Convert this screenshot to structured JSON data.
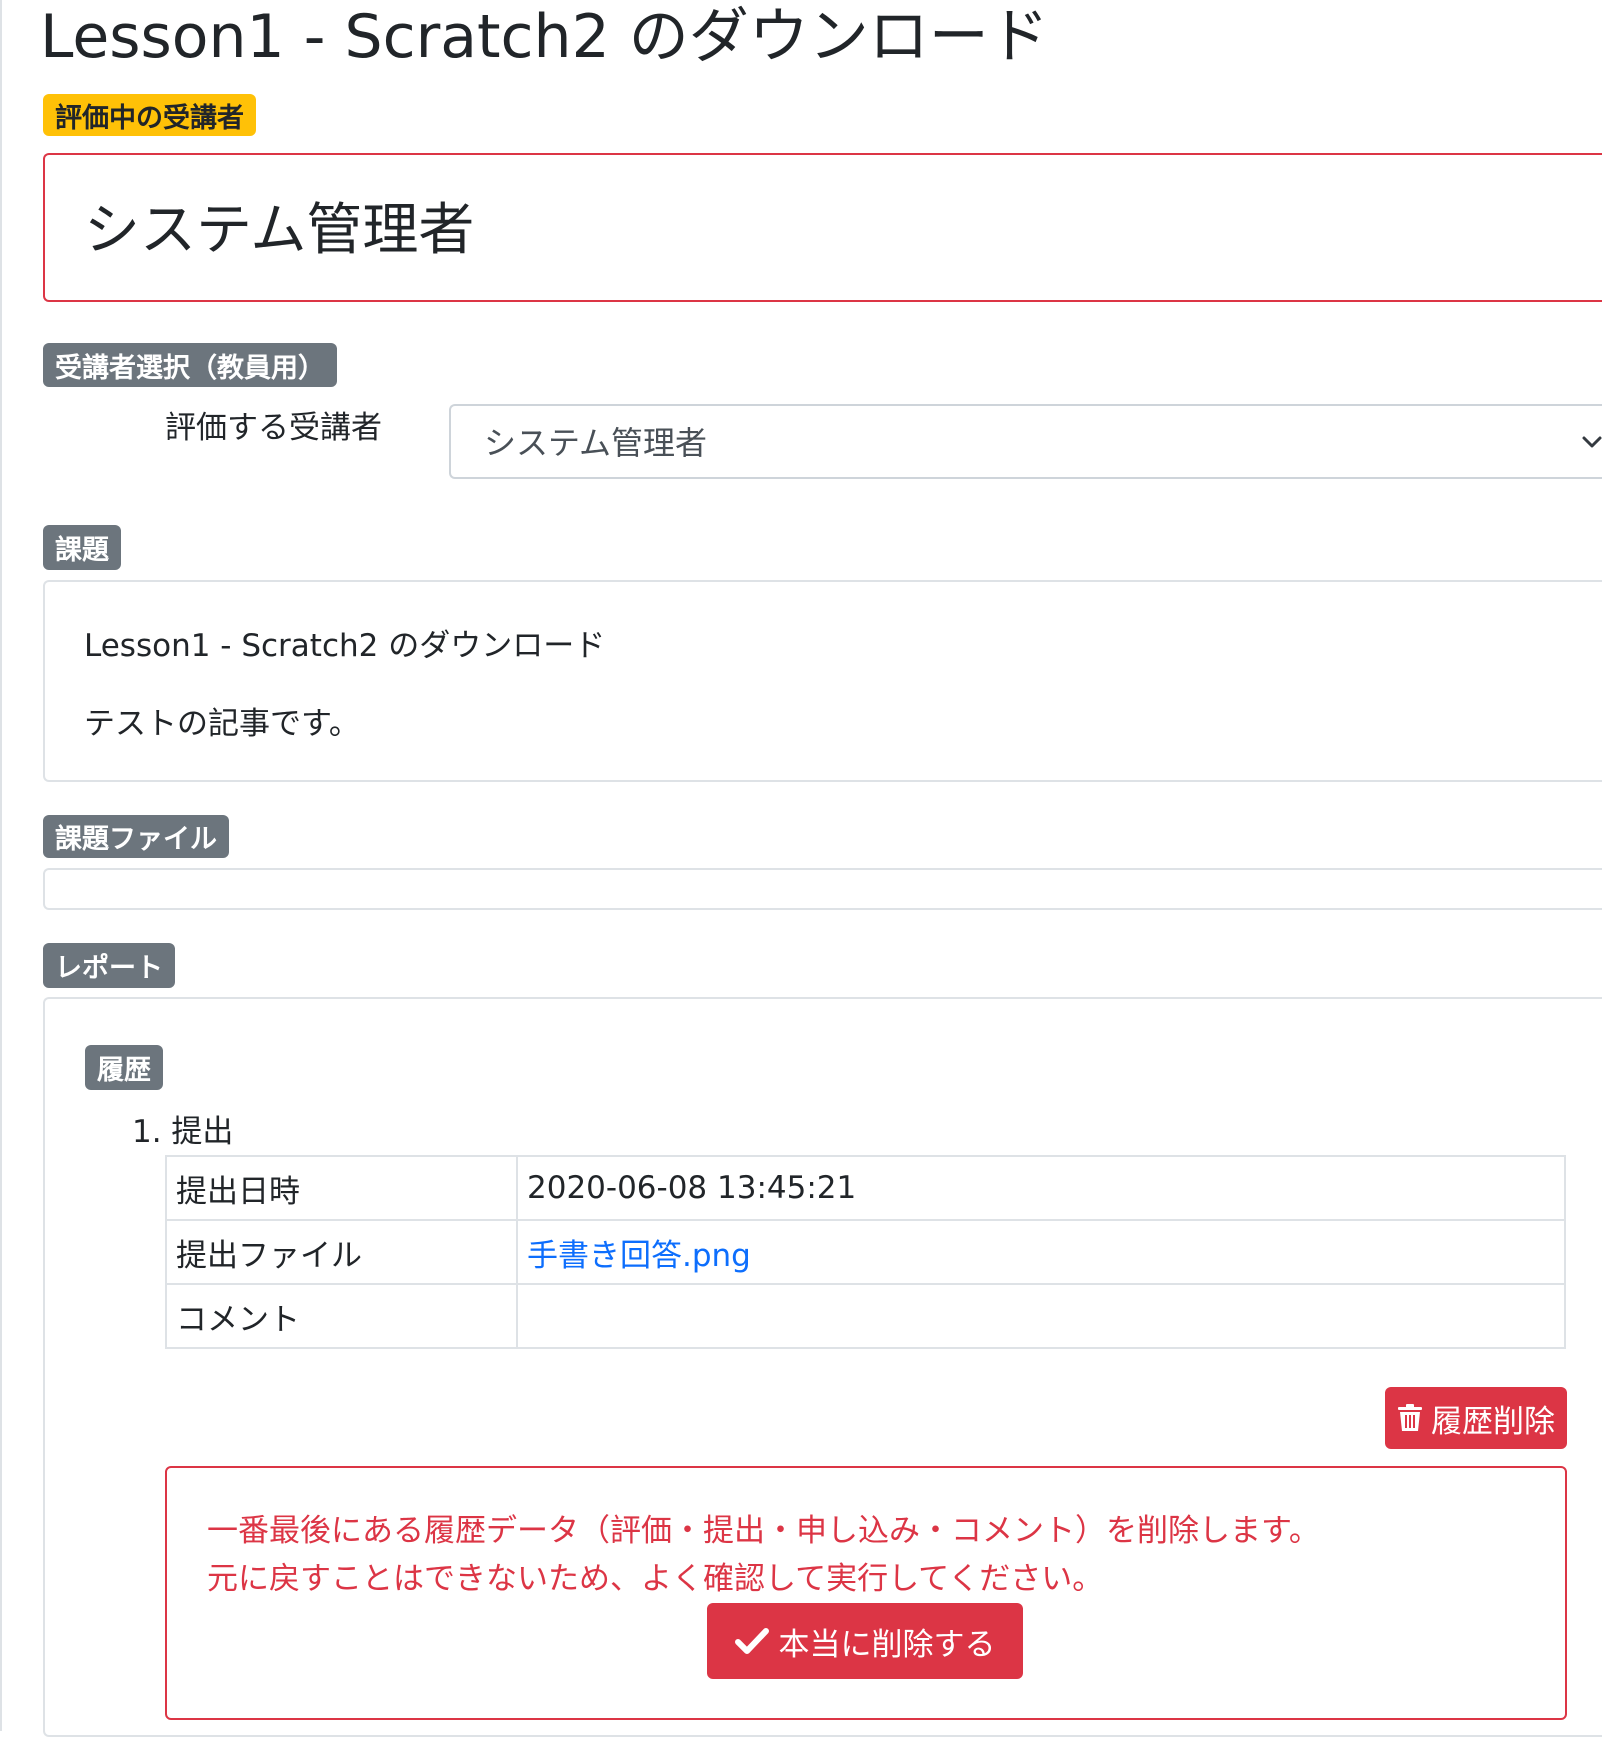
{
  "page": {
    "title": "Lesson1 - Scratch2 のダウンロード"
  },
  "evaluating": {
    "badge": "評価中の受講者",
    "student_name": "システム管理者"
  },
  "student_select": {
    "badge": "受講者選択（教員用）",
    "label": "評価する受講者",
    "selected": "システム管理者"
  },
  "task": {
    "badge": "課題",
    "title": "Lesson1 - Scratch2 のダウンロード",
    "body": "テストの記事です。"
  },
  "task_file": {
    "badge": "課題ファイル"
  },
  "report": {
    "badge": "レポート",
    "history": {
      "badge": "履歴",
      "item_label": "1. 提出",
      "rows": [
        {
          "key": "提出日時",
          "value": "2020-06-08 13:45:21"
        },
        {
          "key": "提出ファイル",
          "value": "手書き回答.png"
        },
        {
          "key": "コメント",
          "value": ""
        }
      ],
      "delete_button": "履歴削除",
      "warning_line1": "一番最後にある履歴データ（評価・提出・申し込み・コメント）を削除します。",
      "warning_line2": "元に戻すことはできないため、よく確認して実行してください。",
      "confirm_button": "本当に削除する"
    }
  },
  "colors": {
    "danger": "#dc3545",
    "warning": "#ffc107",
    "secondary": "#6c757d",
    "link": "#0d6efd"
  },
  "icons": [
    "chevron-down-icon",
    "trash-icon",
    "check-icon"
  ]
}
